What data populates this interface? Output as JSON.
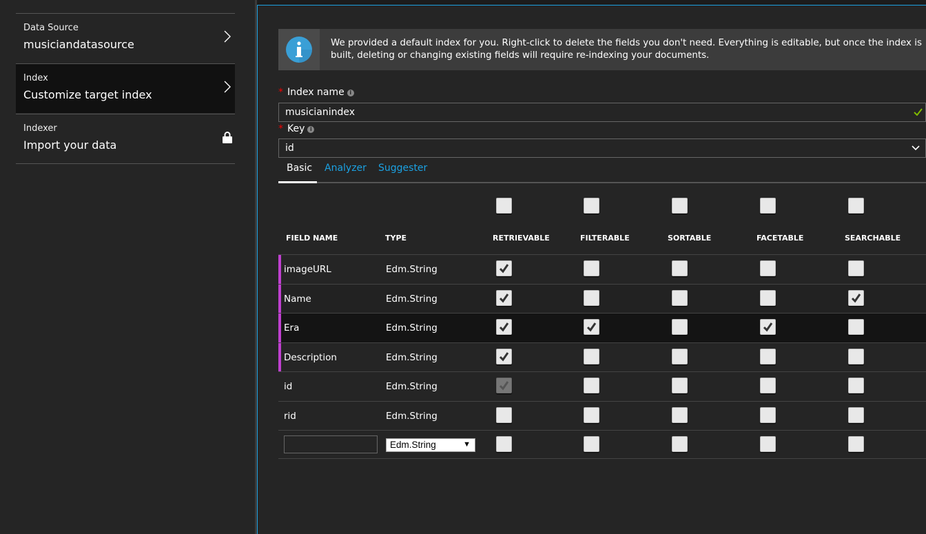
{
  "sidebar": {
    "items": [
      {
        "title": "Data Source",
        "subtitle": "musiciandatasource",
        "icon": "chevron-right-icon",
        "active": false
      },
      {
        "title": "Index",
        "subtitle": "Customize target index",
        "icon": "chevron-right-icon",
        "active": true
      },
      {
        "title": "Indexer",
        "subtitle": "Import your data",
        "icon": "lock-icon",
        "active": false
      }
    ]
  },
  "info": {
    "icon": "info-icon",
    "text": "We provided a default index for you. Right-click to delete the fields you don't need. Everything is editable, but once the index is built, deleting or changing existing fields will require re-indexing your documents."
  },
  "index_name": {
    "label": "Index name",
    "value": "musicianindex",
    "valid_icon": "checkmark-icon"
  },
  "key": {
    "label": "Key",
    "value": "id"
  },
  "tabs": [
    {
      "label": "Basic",
      "active": true
    },
    {
      "label": "Analyzer"
    },
    {
      "label": "Suggester"
    }
  ],
  "table": {
    "headers": [
      "FIELD NAME",
      "TYPE",
      "RETRIEVABLE",
      "FILTERABLE",
      "SORTABLE",
      "FACETABLE",
      "SEARCHABLE"
    ],
    "rows": [
      {
        "name": "imageURL",
        "type": "Edm.String",
        "flags": [
          true,
          false,
          false,
          false,
          false
        ],
        "marked": true
      },
      {
        "name": "Name",
        "type": "Edm.String",
        "flags": [
          true,
          false,
          false,
          false,
          true
        ],
        "marked": true
      },
      {
        "name": "Era",
        "type": "Edm.String",
        "flags": [
          true,
          true,
          false,
          true,
          false
        ],
        "marked": true,
        "selected": true
      },
      {
        "name": "Description",
        "type": "Edm.String",
        "flags": [
          true,
          false,
          false,
          false,
          false
        ],
        "marked": true
      },
      {
        "name": "id",
        "type": "Edm.String",
        "flags": [
          true,
          false,
          false,
          false,
          false
        ],
        "disabled_first": true
      },
      {
        "name": "rid",
        "type": "Edm.String",
        "flags": [
          false,
          false,
          false,
          false,
          false
        ]
      }
    ],
    "new_row": {
      "name": "",
      "type": "Edm.String"
    }
  },
  "colors": {
    "accent": "#1ba1e2",
    "marker": "#c040d0",
    "required": "#ee0000",
    "valid": "#7fba00"
  }
}
